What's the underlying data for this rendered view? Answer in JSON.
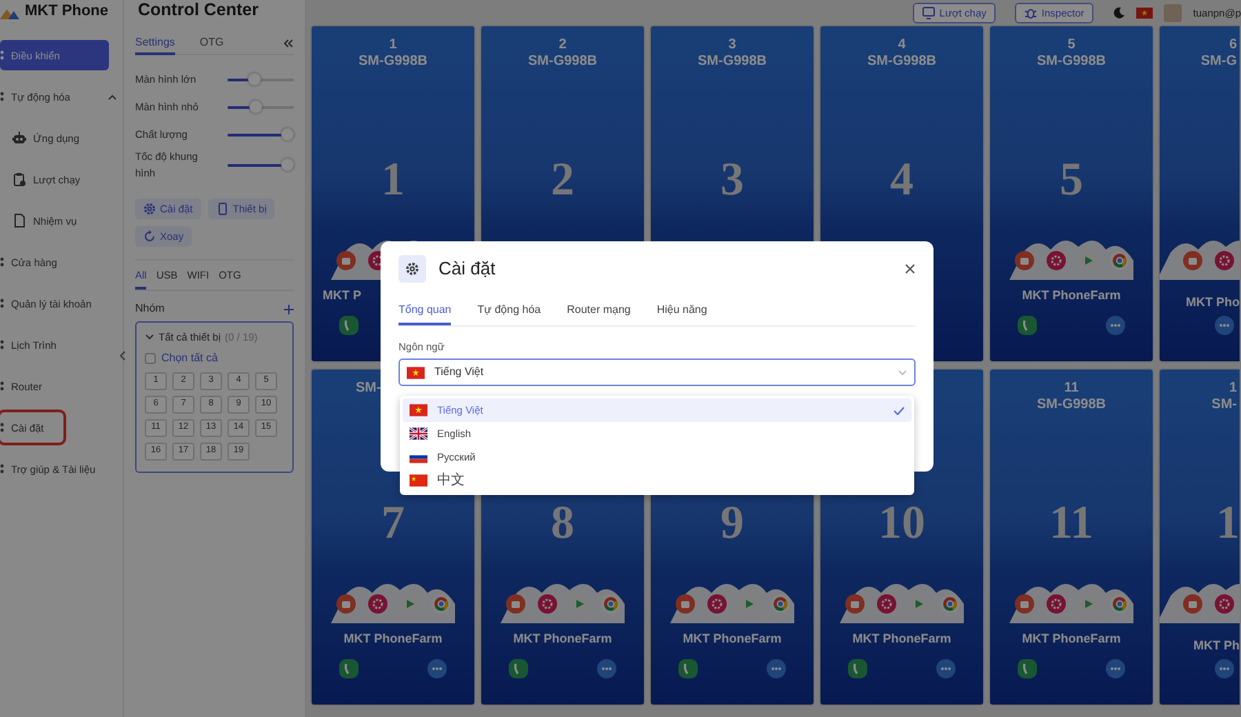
{
  "sidebar": {
    "logo": "MKT Phone",
    "items": [
      {
        "label": "Điều khiển",
        "selected": true,
        "highlighted": false
      },
      {
        "label": "Tự động hóa",
        "selected": false,
        "highlighted": false,
        "expanded": true,
        "children": [
          {
            "label": "Ứng dụng",
            "selected": false
          },
          {
            "label": "Lượt chạy",
            "selected": false
          },
          {
            "label": "Nhiệm vụ",
            "selected": false
          }
        ]
      },
      {
        "label": "Cửa hàng",
        "selected": false,
        "highlighted": false
      },
      {
        "label": "Quản lý tài khoản",
        "selected": false,
        "highlighted": false
      },
      {
        "label": "Lịch Trình",
        "selected": false,
        "highlighted": false
      },
      {
        "label": "Router",
        "selected": false,
        "highlighted": false
      },
      {
        "label": "Cài đặt",
        "selected": false,
        "highlighted": true
      },
      {
        "label": "Trợ giúp & Tài liệu",
        "selected": false,
        "highlighted": false
      }
    ]
  },
  "control_panel": {
    "title": "Control Center",
    "tabs": [
      {
        "label": "Settings",
        "selected": true
      },
      {
        "label": "OTG",
        "selected": false
      }
    ],
    "sliders": [
      {
        "label": "Màn hình lớn",
        "level": 0.42
      },
      {
        "label": "Màn hình nhỏ",
        "level": 0.44
      },
      {
        "label": "Chất lượng",
        "level": 1
      },
      {
        "label": "Tốc độ khung hình",
        "level": 1
      }
    ],
    "buttons": [
      {
        "label": "Cài đặt"
      },
      {
        "label": "Thiết bị"
      },
      {
        "label": "Xoay"
      }
    ],
    "filters": [
      {
        "label": "All",
        "selected": true
      },
      {
        "label": "USB",
        "selected": false
      },
      {
        "label": "WIFI",
        "selected": false
      },
      {
        "label": "OTG",
        "selected": false
      }
    ],
    "group_label": "Nhóm",
    "group": {
      "label": "Tất cả thiết bị",
      "count": "(0 / 19)",
      "expanded": true,
      "select_all": {
        "label": "Chọn tất cả",
        "checked": false
      },
      "devices": [
        "1",
        "2",
        "3",
        "4",
        "5",
        "6",
        "7",
        "8",
        "9",
        "10",
        "11",
        "12",
        "13",
        "14",
        "15",
        "16",
        "17",
        "18",
        "19"
      ]
    }
  },
  "topbar": {
    "buttons": [
      {
        "label": "Lượt chạy"
      },
      {
        "label": "Inspector"
      }
    ],
    "user": "tuanpn@p"
  },
  "phones": [
    {
      "kind": "clip-label",
      "number": "1",
      "model": "SM-G998B",
      "big_number": "1",
      "home_icons": true,
      "app_label": "MKT P"
    },
    {
      "kind": "full",
      "number": "2",
      "model": "SM-G998B",
      "big_number": "2",
      "home_icons": false
    },
    {
      "kind": "full",
      "number": "3",
      "model": "SM-G998B",
      "big_number": "3",
      "home_icons": false
    },
    {
      "kind": "full",
      "number": "4",
      "model": "SM-G998B",
      "big_number": "4",
      "home_icons": false
    },
    {
      "kind": "full",
      "number": "5",
      "model": "SM-G998B",
      "big_number": "5",
      "home_icons": true,
      "app_label": "MKT PhoneFarm"
    },
    {
      "kind": "partial",
      "number": "6",
      "model": "SM-G",
      "home_icons": true,
      "app_label": "MKT Pho"
    },
    {
      "kind": "clip-header",
      "model": "SM-",
      "big_number": "7",
      "home_icons": true,
      "app_label": "MKT PhoneFarm"
    },
    {
      "kind": "full",
      "big_number": "8",
      "home_icons": true,
      "app_label": "MKT PhoneFarm"
    },
    {
      "kind": "full",
      "big_number": "9",
      "home_icons": true,
      "app_label": "MKT PhoneFarm"
    },
    {
      "kind": "full",
      "big_number": "10",
      "home_icons": true,
      "app_label": "MKT PhoneFarm"
    },
    {
      "kind": "full",
      "number": "11",
      "model": "SM-G998B",
      "big_number": "11",
      "home_icons": true,
      "app_label": "MKT PhoneFarm"
    },
    {
      "kind": "partial",
      "number": "1",
      "model": "SM-",
      "big_number": "1",
      "home_icons": true,
      "app_label": "MKT Ph"
    }
  ],
  "modal": {
    "title": "Cài đặt",
    "tabs": [
      {
        "label": "Tổng quan",
        "selected": true
      },
      {
        "label": "Tự động hóa",
        "selected": false
      },
      {
        "label": "Router mạng",
        "selected": false
      },
      {
        "label": "Hiệu năng",
        "selected": false
      }
    ],
    "field_label": "Ngôn ngữ",
    "select": {
      "value": "Tiếng Việt",
      "open": true
    },
    "options": [
      {
        "label": "Tiếng Việt",
        "selected": true
      },
      {
        "label": "English",
        "selected": false
      },
      {
        "label": "Русский",
        "selected": false
      },
      {
        "label": "中文",
        "selected": false
      }
    ]
  }
}
